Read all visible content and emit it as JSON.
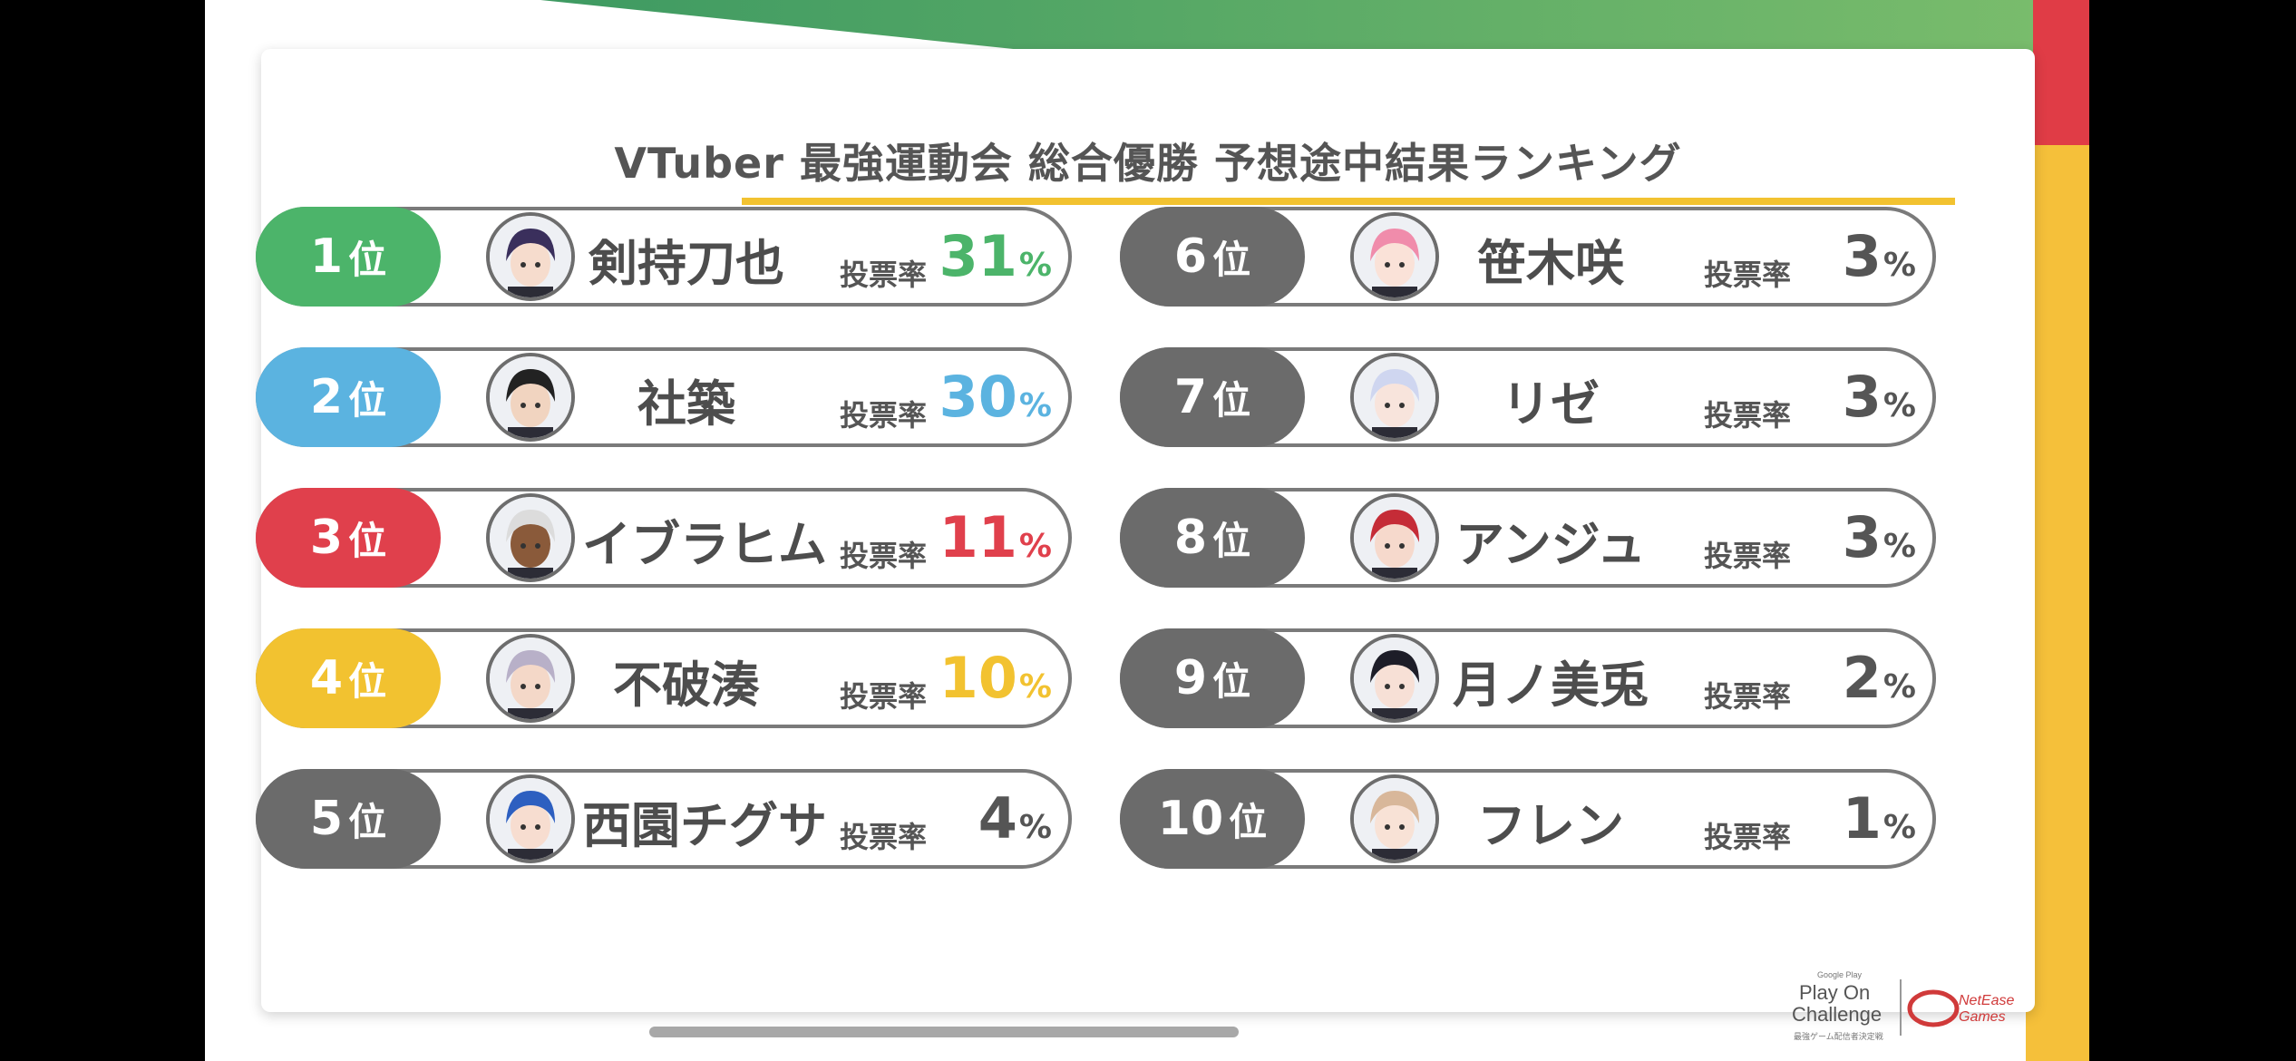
{
  "title": "VTuber 最強運動会 総合優勝 予想途中結果ランキング",
  "vote_label": "投票率",
  "rank_suffix": "位",
  "percent_unit": "%",
  "colors": {
    "rank1": "#4cb46a",
    "rank2": "#5bb3e0",
    "rank3": "#e0404c",
    "rank4": "#f2c230",
    "other": "#6b6b6b",
    "text": "#4d4d4d"
  },
  "rankings": [
    {
      "rank": "1",
      "name": "剣持刀也",
      "percent": 31,
      "color": "#4cb46a",
      "avatar": "avatar-purple-hair"
    },
    {
      "rank": "2",
      "name": "社築",
      "percent": 30,
      "color": "#5bb3e0",
      "avatar": "avatar-black-hair"
    },
    {
      "rank": "3",
      "name": "イブラヒム",
      "percent": 11,
      "color": "#e0404c",
      "avatar": "avatar-white-hair"
    },
    {
      "rank": "4",
      "name": "不破湊",
      "percent": 10,
      "color": "#f2c230",
      "avatar": "avatar-silver-hair"
    },
    {
      "rank": "5",
      "name": "西園チグサ",
      "percent": 4,
      "color": "#6b6b6b",
      "avatar": "avatar-blue-hair"
    },
    {
      "rank": "6",
      "name": "笹木咲",
      "percent": 3,
      "color": "#6b6b6b",
      "avatar": "avatar-pink-hair"
    },
    {
      "rank": "7",
      "name": "リゼ",
      "percent": 3,
      "color": "#6b6b6b",
      "avatar": "avatar-lavender-hair"
    },
    {
      "rank": "8",
      "name": "アンジュ",
      "percent": 3,
      "color": "#6b6b6b",
      "avatar": "avatar-red-hair"
    },
    {
      "rank": "9",
      "name": "月ノ美兎",
      "percent": 2,
      "color": "#6b6b6b",
      "avatar": "avatar-dark-hair"
    },
    {
      "rank": "10",
      "name": "フレン",
      "percent": 1,
      "color": "#6b6b6b",
      "avatar": "avatar-blonde-hair"
    }
  ],
  "logo": {
    "google_play": "Google Play",
    "line1": "Play On",
    "line2": "Challenge",
    "subtitle": "最強ゲーム配信者決定戦",
    "netease": "NetEase",
    "games": "Games"
  }
}
